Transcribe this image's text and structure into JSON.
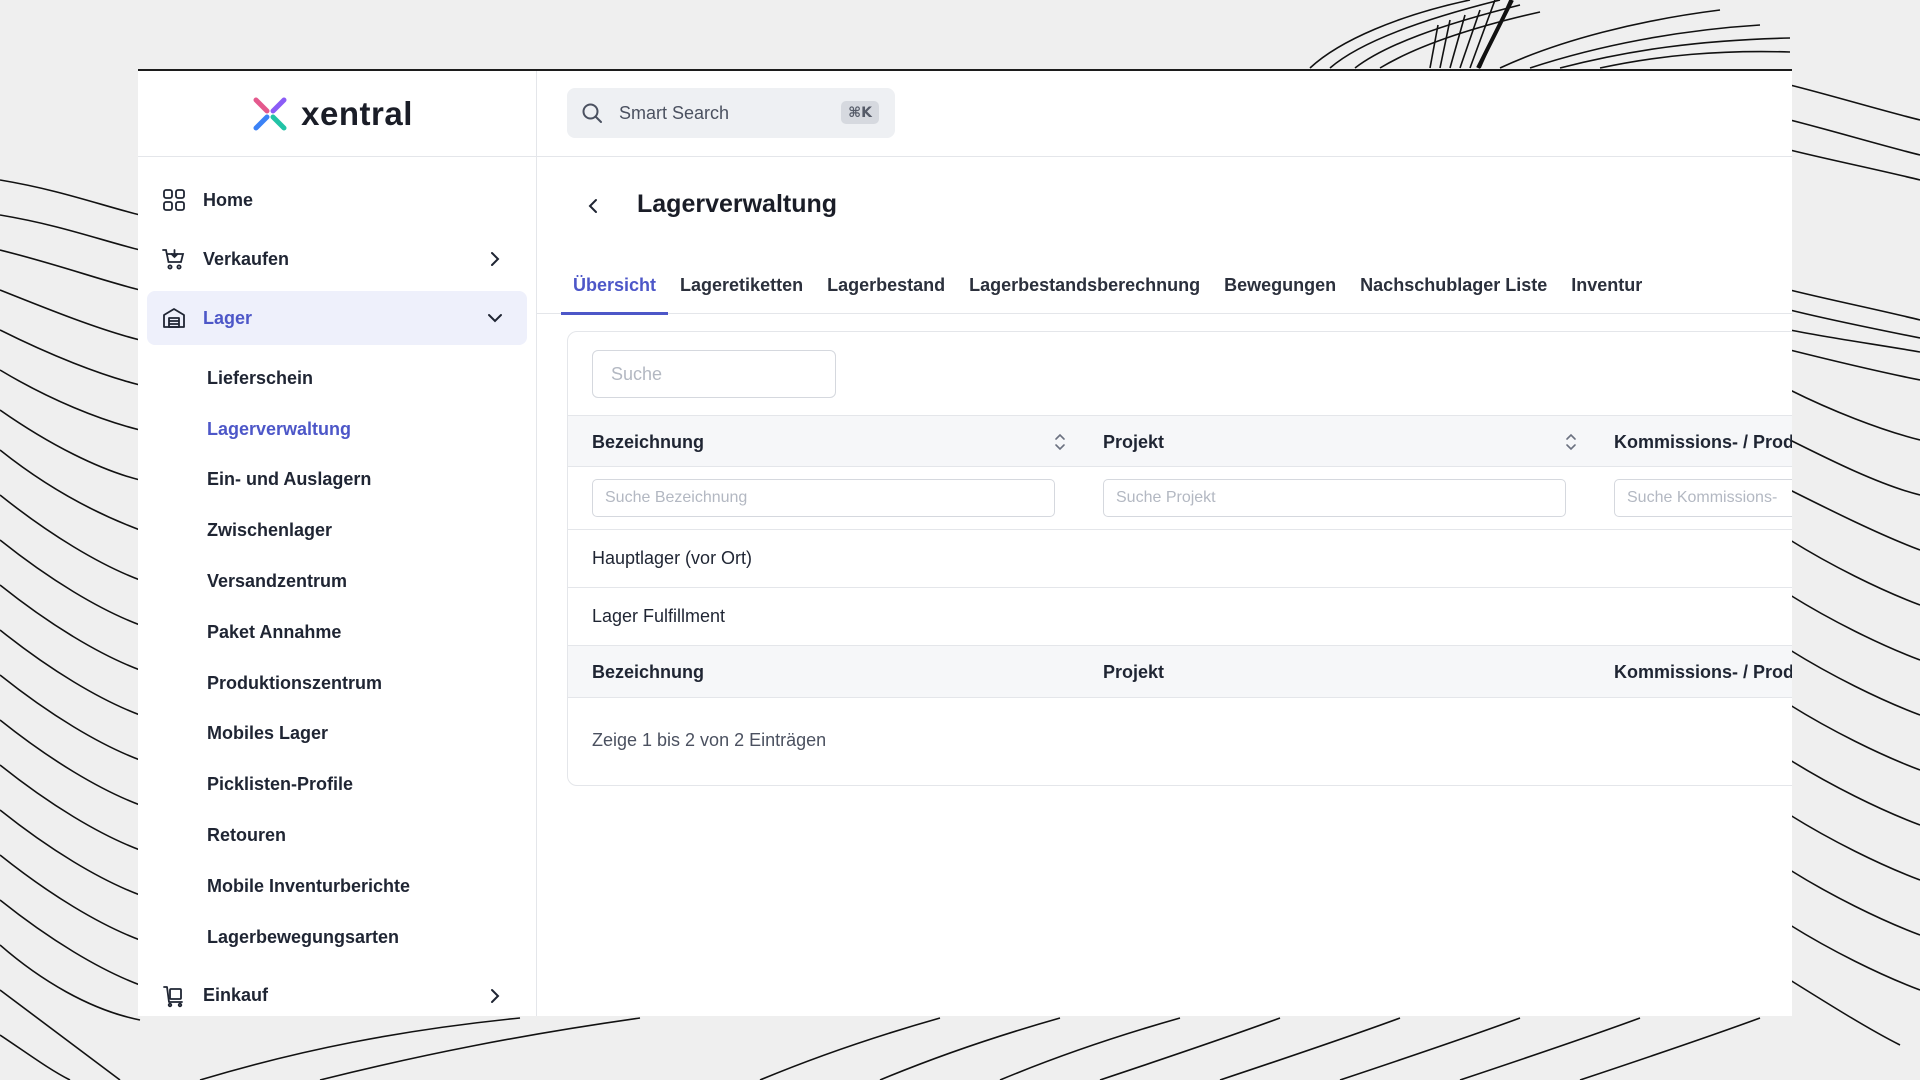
{
  "brand": {
    "name": "xentral"
  },
  "sidebar": {
    "items": [
      {
        "label": "Home",
        "icon": "grid-icon"
      },
      {
        "label": "Verkaufen",
        "icon": "cart-icon"
      },
      {
        "label": "Lager",
        "icon": "warehouse-icon"
      },
      {
        "label": "Einkauf",
        "icon": "trolley-icon"
      }
    ],
    "lager_sub": [
      "Lieferschein",
      "Lagerverwaltung",
      "Ein- und Auslagern",
      "Zwischenlager",
      "Versandzentrum",
      "Paket Annahme",
      "Produktionszentrum",
      "Mobiles Lager",
      "Picklisten-Profile",
      "Retouren",
      "Mobile Inventurberichte",
      "Lagerbewegungsarten"
    ],
    "active_sub": "Lagerverwaltung"
  },
  "topbar": {
    "search_placeholder": "Smart Search",
    "shortcut": "⌘K"
  },
  "page": {
    "title": "Lagerverwaltung",
    "tabs": [
      "Übersicht",
      "Lageretiketten",
      "Lagerbestand",
      "Lagerbestandsberechnung",
      "Bewegungen",
      "Nachschublager Liste",
      "Inventur"
    ],
    "active_tab": "Übersicht"
  },
  "table": {
    "search_placeholder": "Suche",
    "columns": [
      "Bezeichnung",
      "Projekt",
      "Kommissions- / Prod"
    ],
    "filter_placeholders": [
      "Suche Bezeichnung",
      "Suche Projekt",
      "Suche Kommissions-"
    ],
    "rows": [
      {
        "bezeichnung": "Hauptlager (vor Ort)",
        "projekt": ""
      },
      {
        "bezeichnung": "Lager Fulfillment",
        "projekt": ""
      }
    ],
    "info": "Zeige 1 bis 2 von 2 Einträgen"
  },
  "colors": {
    "accent": "#4d57c8",
    "active_bg": "#eef0fb",
    "border": "#e4e6ea"
  }
}
